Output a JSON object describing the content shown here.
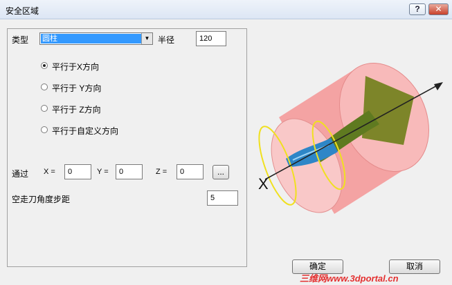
{
  "window": {
    "title": "安全区域",
    "help_label": "?",
    "close_label": "✕"
  },
  "form": {
    "type_label": "类型",
    "type_value": "圆柱",
    "radius_label": "半径",
    "radius_value": "120",
    "options": [
      "平行于X方向",
      "平行于 Y方向",
      "平行于 Z方向",
      "平行于自定义方向"
    ],
    "through_label": "通过",
    "x_label": "X =",
    "x_value": "0",
    "y_label": "Y =",
    "y_value": "0",
    "z_label": "Z =",
    "z_value": "0",
    "browse_label": "...",
    "step_label": "空走刀角度步距",
    "step_value": "5"
  },
  "illustration": {
    "axis_label": "X"
  },
  "buttons": {
    "ok_label": "确定",
    "cancel_label": "取消"
  },
  "watermark": "三维网www.3dportal.cn"
}
